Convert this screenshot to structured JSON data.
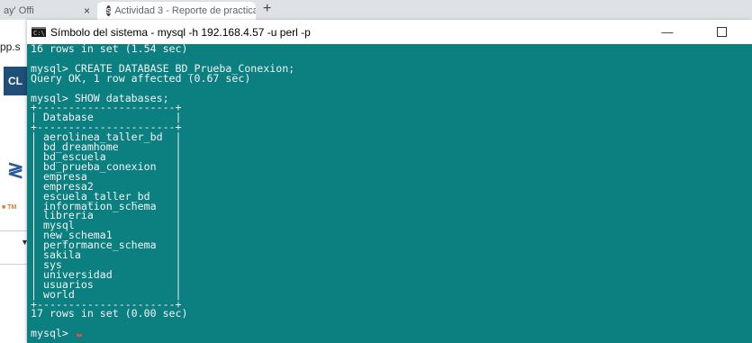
{
  "browser": {
    "tab1_label": "ay' Offi",
    "tab2_label": "Actividad 3 - Reporte de practica",
    "tab2_favicon": "S",
    "close_glyph": "×",
    "new_tab_glyph": "+"
  },
  "background_page": {
    "url_fragment": "pp.s",
    "cl_label": "CL",
    "logo_fragment": "≷",
    "tm_label": "■ TM"
  },
  "console": {
    "title": "Símbolo del sistema - mysql  -h 192.168.4.57 -u perl -p",
    "minimize_glyph": "—",
    "background_color": "#0c7f80",
    "text_color": "#f2f2f2",
    "lines": [
      "16 rows in set (1.54 sec)",
      "",
      "mysql> CREATE DATABASE BD_Prueba_Conexion;",
      "Query OK, 1 row affected (0.67 sec)",
      "",
      "mysql> SHOW databases;",
      "+----------------------+",
      "| Database             |",
      "+----------------------+",
      "| aerolinea_taller_bd  |",
      "| bd_dreamhome         |",
      "| bd_escuela           |",
      "| bd_prueba_conexion   |",
      "| empresa              |",
      "| empresa2             |",
      "| escuela_taller_bd    |",
      "| information_schema   |",
      "| libreria             |",
      "| mysql                |",
      "| new_schema1          |",
      "| performance_schema   |",
      "| sakila               |",
      "| sys                  |",
      "| universidad          |",
      "| usuarios             |",
      "| world                |",
      "+----------------------+",
      "17 rows in set (0.00 sec)",
      "",
      "mysql> "
    ],
    "cursor_color": "#e8484f"
  }
}
